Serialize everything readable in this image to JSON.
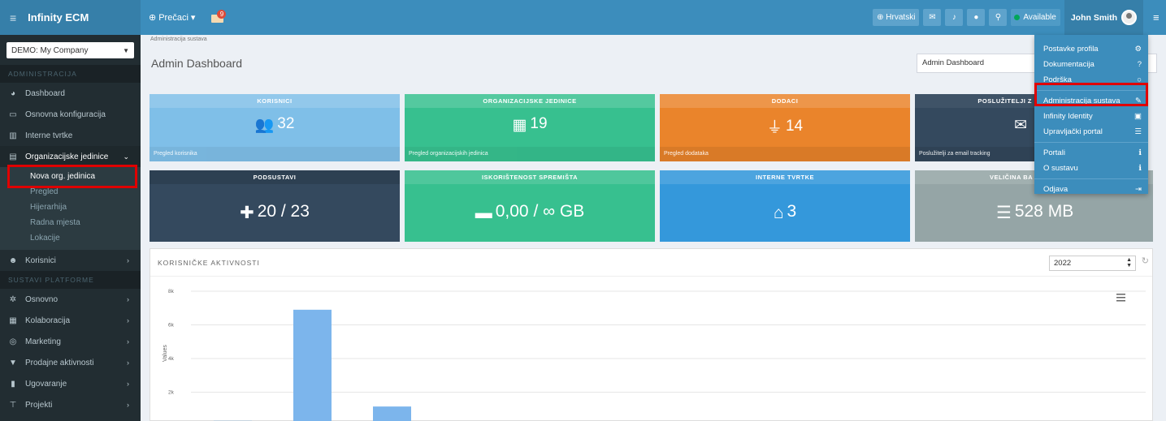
{
  "topbar": {
    "brand": "Infinity ECM",
    "shortcuts": "Prečaci",
    "mail_count": "9",
    "language": "Hrvatski",
    "status": "Available",
    "user_name": "John Smith"
  },
  "sidebar": {
    "company": "DEMO: My Company",
    "section_admin": "ADMINISTRACIJA",
    "admin_items": [
      {
        "label": "Dashboard",
        "icon": "dashboard-icon"
      },
      {
        "label": "Osnovna konfiguracija",
        "icon": "monitor-icon"
      },
      {
        "label": "Interne tvrtke",
        "icon": "buildings-icon"
      },
      {
        "label": "Organizacijske jedinice",
        "icon": "building-icon"
      }
    ],
    "org_sub_items": [
      "Nova org. jedinica",
      "Pregled",
      "Hijerarhija",
      "Radna mjesta",
      "Lokacije"
    ],
    "users_label": "Korisnici",
    "section_platform": "SUSTAVI PLATFORME",
    "platform_items": [
      {
        "label": "Osnovno",
        "icon": "gear-icon"
      },
      {
        "label": "Kolaboracija",
        "icon": "calendar-icon"
      },
      {
        "label": "Marketing",
        "icon": "target-icon"
      },
      {
        "label": "Prodajne aktivnosti",
        "icon": "funnel-icon"
      },
      {
        "label": "Ugovaranje",
        "icon": "document-icon"
      },
      {
        "label": "Projekti",
        "icon": "sitemap-icon"
      }
    ]
  },
  "content": {
    "breadcrumb": "Administracija sustava",
    "title": "Admin Dashboard",
    "title_select": "Admin Dashboard"
  },
  "tiles": [
    {
      "title": "KORISNICI",
      "value": "32",
      "footer": "Pregled korisnika",
      "color": "#7fbfe8",
      "icon": "users-icon"
    },
    {
      "title": "ORGANIZACIJSKE JEDINICE",
      "value": "19",
      "footer": "Pregled organizacijskih jedinica",
      "color": "#37c08f",
      "icon": "building-icon"
    },
    {
      "title": "DODACI",
      "value": "14",
      "footer": "Pregled dodataka",
      "color": "#ea842b",
      "icon": "plug-icon"
    },
    {
      "title": "POSLUŽITELJI Z",
      "value": "",
      "footer": "Poslužitelji za email tracking",
      "color": "#34495e",
      "icon": "envelope-icon"
    },
    {
      "title": "PODSUSTAVI",
      "value": "20 / 23",
      "footer": "",
      "color": "#34495e",
      "icon": "puzzle-icon"
    },
    {
      "title": "ISKORIŠTENOST SPREMIŠTA",
      "value": "0,00 / ∞ GB",
      "footer": "",
      "color": "#37c08f",
      "icon": "hdd-icon"
    },
    {
      "title": "INTERNE TVRTKE",
      "value": "3",
      "footer": "",
      "color": "#3498db",
      "icon": "home-icon"
    },
    {
      "title": "VELIČINA BA",
      "value": "528 MB",
      "footer": "",
      "color": "#95a5a6",
      "icon": "database-icon"
    }
  ],
  "activity": {
    "title": "KORISNIČKE AKTIVNOSTI",
    "year": "2022"
  },
  "chart_data": {
    "type": "bar",
    "ylabel": "Values",
    "yticks": [
      "8k",
      "6k",
      "4k",
      "2k"
    ],
    "ylim": [
      0,
      8000
    ],
    "values": [
      300,
      6900,
      1150
    ],
    "bar_color": "#7cb5ec",
    "grid": true
  },
  "dropdown": {
    "items": [
      {
        "label": "Postavke profila",
        "icon": "cogs-icon"
      },
      {
        "label": "Dokumentacija",
        "icon": "question-icon"
      },
      {
        "label": "Podrška",
        "icon": "chat-icon"
      },
      {
        "label": "Administracija sustava",
        "icon": "wrench-icon"
      },
      {
        "label": "Infinity Identity",
        "icon": "id-card-icon"
      },
      {
        "label": "Upravljački portal",
        "icon": "list-icon"
      },
      {
        "label": "Portali",
        "icon": "info-icon"
      },
      {
        "label": "O sustavu",
        "icon": "info-icon"
      },
      {
        "label": "Odjava",
        "icon": "sign-out-icon"
      }
    ]
  }
}
